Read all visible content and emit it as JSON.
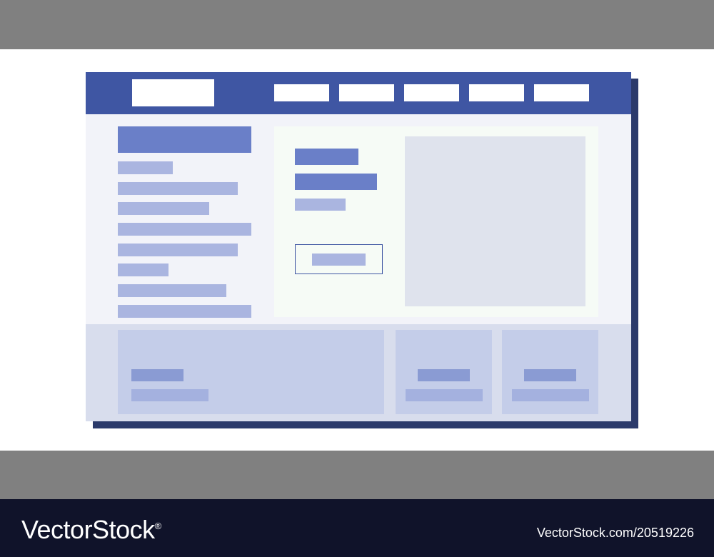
{
  "credit": {
    "brand": "VectorStock",
    "registered_mark": "®",
    "stock_id": "VectorStock.com/20519226"
  },
  "wireframe": {
    "nav_item_count": 5,
    "sidebar_line_count": 8,
    "footer_card_count": 3
  }
}
